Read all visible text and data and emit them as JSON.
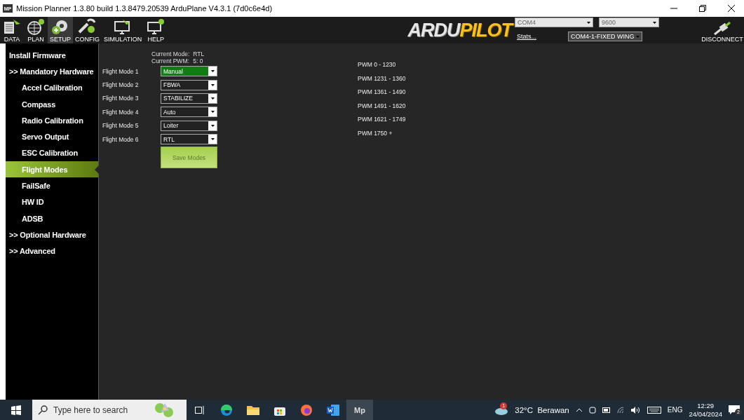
{
  "window": {
    "title": "Mission Planner 1.3.80 build 1.3.8479.20539 ArduPlane V4.3.1 (7d0c6e4d)",
    "app_badge": "MP"
  },
  "toolbar": {
    "buttons": [
      {
        "label": "DATA",
        "selected": false
      },
      {
        "label": "PLAN",
        "selected": false
      },
      {
        "label": "SETUP",
        "selected": true
      },
      {
        "label": "CONFIG",
        "selected": false
      },
      {
        "label": "SIMULATION",
        "selected": false
      },
      {
        "label": "HELP",
        "selected": false
      }
    ],
    "logo": {
      "part_1": "ARDU",
      "part_2": "PILOT"
    },
    "port": "COM4",
    "baud": "9600",
    "stats": "Stats...",
    "vehicle": "COM4-1-FIXED WING",
    "connect": "DISCONNECT"
  },
  "sidebar": {
    "items": [
      {
        "label": "Install Firmware",
        "kind": "section",
        "selected": false
      },
      {
        "label": ">> Mandatory Hardware",
        "kind": "section",
        "selected": false
      },
      {
        "label": "Accel Calibration",
        "kind": "item",
        "selected": false
      },
      {
        "label": "Compass",
        "kind": "item",
        "selected": false
      },
      {
        "label": "Radio Calibration",
        "kind": "item",
        "selected": false
      },
      {
        "label": "Servo Output",
        "kind": "item",
        "selected": false
      },
      {
        "label": "ESC Calibration",
        "kind": "item",
        "selected": false
      },
      {
        "label": "Flight Modes",
        "kind": "item",
        "selected": true
      },
      {
        "label": "FailSafe",
        "kind": "item",
        "selected": false
      },
      {
        "label": "HW ID",
        "kind": "item",
        "selected": false
      },
      {
        "label": "ADSB",
        "kind": "item",
        "selected": false
      },
      {
        "label": ">> Optional Hardware",
        "kind": "section",
        "selected": false
      },
      {
        "label": ">> Advanced",
        "kind": "section",
        "selected": false
      }
    ]
  },
  "flight_modes": {
    "current_mode_label": "Current Mode:",
    "current_mode": "RTL",
    "current_pwm_label": "Current PWM:",
    "current_pwm": "5: 0",
    "modes": [
      {
        "label": "Flight Mode 1",
        "value": "Manual",
        "active": true
      },
      {
        "label": "Flight Mode 2",
        "value": "FBWA",
        "active": false
      },
      {
        "label": "Flight Mode 3",
        "value": "STABILIZE",
        "active": false
      },
      {
        "label": "Flight Mode 4",
        "value": "Auto",
        "active": false
      },
      {
        "label": "Flight Mode 5",
        "value": "Loiter",
        "active": false
      },
      {
        "label": "Flight Mode 6",
        "value": "RTL",
        "active": false
      }
    ],
    "save_button": "Save Modes",
    "pwm_ranges": [
      "PWM 0 - 1230",
      "PWM 1231 - 1360",
      "PWM 1361 - 1490",
      "PWM 1491 - 1620",
      "PWM 1621 - 1749",
      "PWM 1750 +"
    ]
  },
  "taskbar": {
    "search_placeholder": "Type here to search",
    "app_label": "Mp",
    "weather_badge": "1",
    "weather": "32°C  Berawan",
    "language": "ENG",
    "time": "12:29",
    "date": "24/04/2024",
    "notification_count": "2"
  }
}
